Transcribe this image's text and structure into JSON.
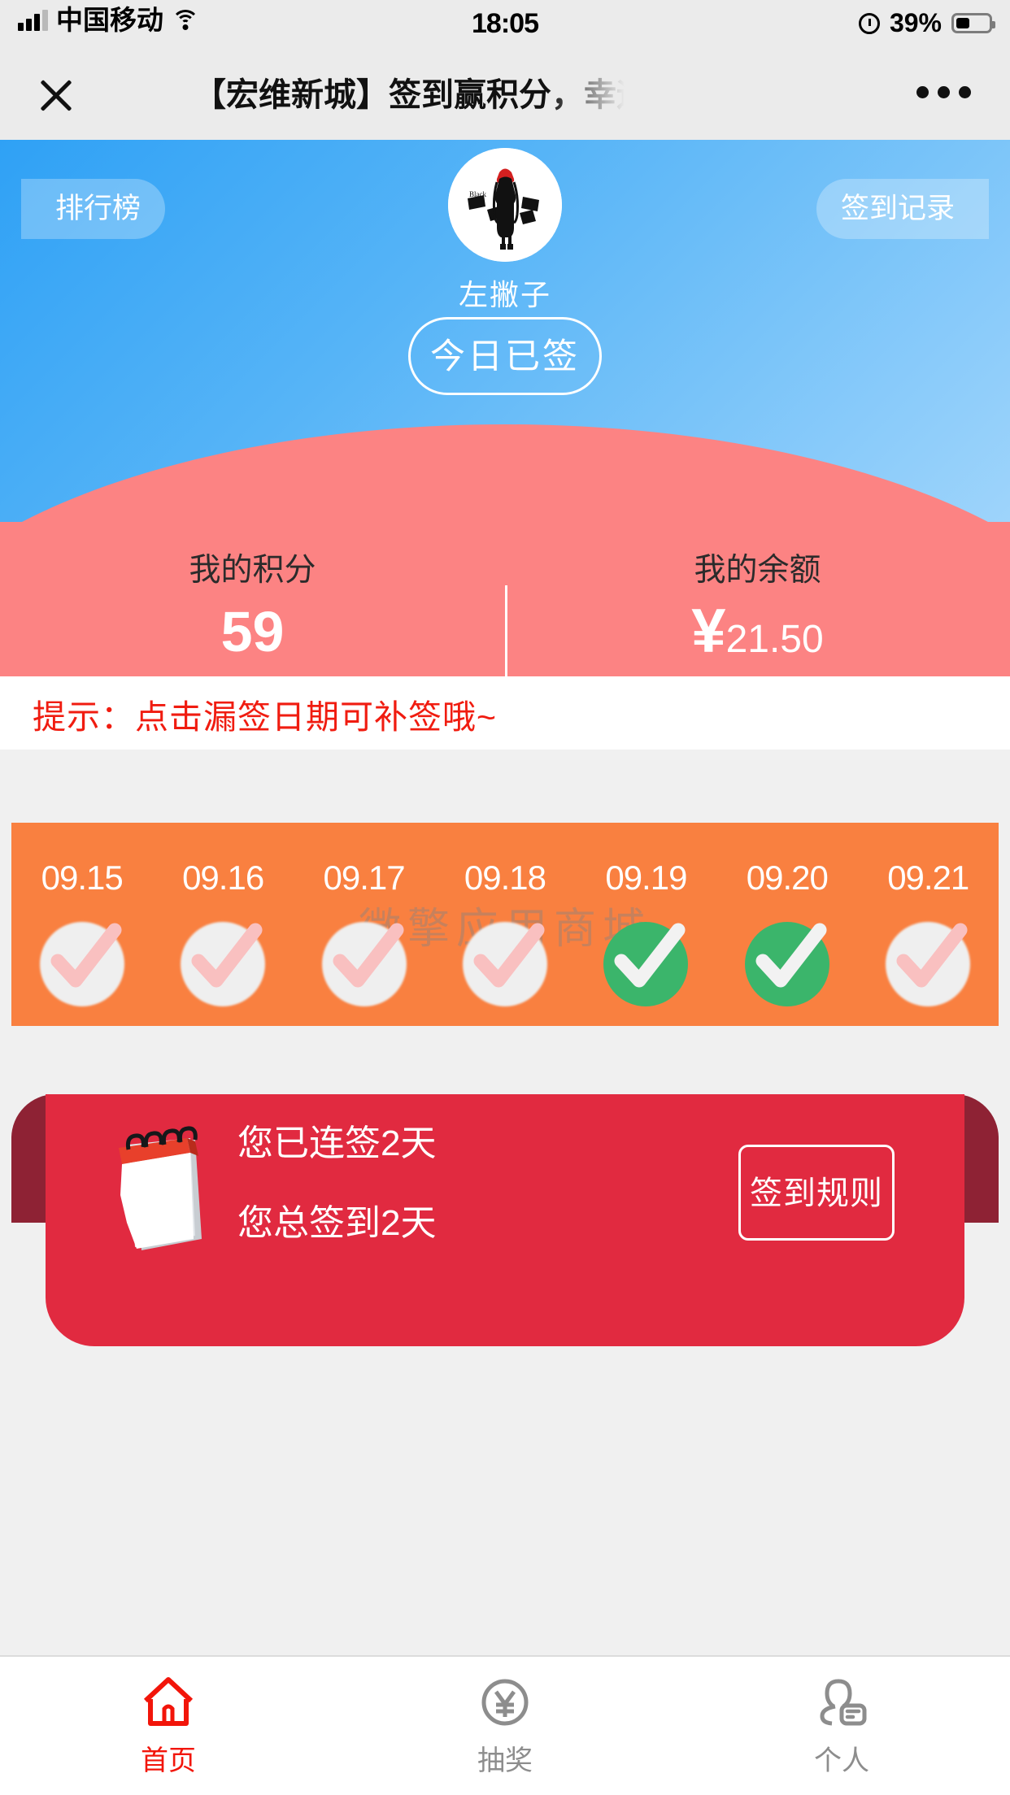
{
  "statusbar": {
    "carrier": "中国移动",
    "time": "18:05",
    "battery_percent": "39%",
    "icons": [
      "signal-icon",
      "wifi-icon",
      "alarm-icon",
      "battery-icon"
    ]
  },
  "navbar": {
    "title": "【宏维新城】签到赢积分，幸运大",
    "close_icon": "close-icon",
    "more_icon": "more-icon"
  },
  "hero": {
    "rank_button": "排行榜",
    "record_button": "签到记录",
    "username": "左撇子",
    "sign_button": "今日已签",
    "avatar_icon": "avatar-image",
    "bg_color": "#56b4f7"
  },
  "stats": {
    "points_label": "我的积分",
    "points_value": "59",
    "balance_label": "我的余额",
    "balance_symbol": "¥",
    "balance_value": "21.50",
    "bg_color": "#FC8383"
  },
  "hint": {
    "text": "提示：点击漏签日期可补签哦~",
    "color": "#f01c10"
  },
  "calendar": {
    "watermark": "微擎应用商城",
    "bg_color": "#F98040",
    "signed_color": "#3BB56B",
    "days": [
      {
        "date": "09.15",
        "signed": false
      },
      {
        "date": "09.16",
        "signed": false
      },
      {
        "date": "09.17",
        "signed": false
      },
      {
        "date": "09.18",
        "signed": false
      },
      {
        "date": "09.19",
        "signed": true
      },
      {
        "date": "09.20",
        "signed": true
      },
      {
        "date": "09.21",
        "signed": false
      }
    ]
  },
  "summary": {
    "streak_text": "您已连签2天",
    "total_text": "您总签到2天",
    "rule_button": "签到规则",
    "calendar_icon": "calendar-icon",
    "bg_color": "#E12A40"
  },
  "tabbar": {
    "items": [
      {
        "label": "首页",
        "icon": "home-icon",
        "active": true
      },
      {
        "label": "抽奖",
        "icon": "coin-yen-icon",
        "active": false
      },
      {
        "label": "个人",
        "icon": "user-card-icon",
        "active": false
      }
    ],
    "active_color": "#f2150a",
    "inactive_color": "#8d8d8d"
  }
}
